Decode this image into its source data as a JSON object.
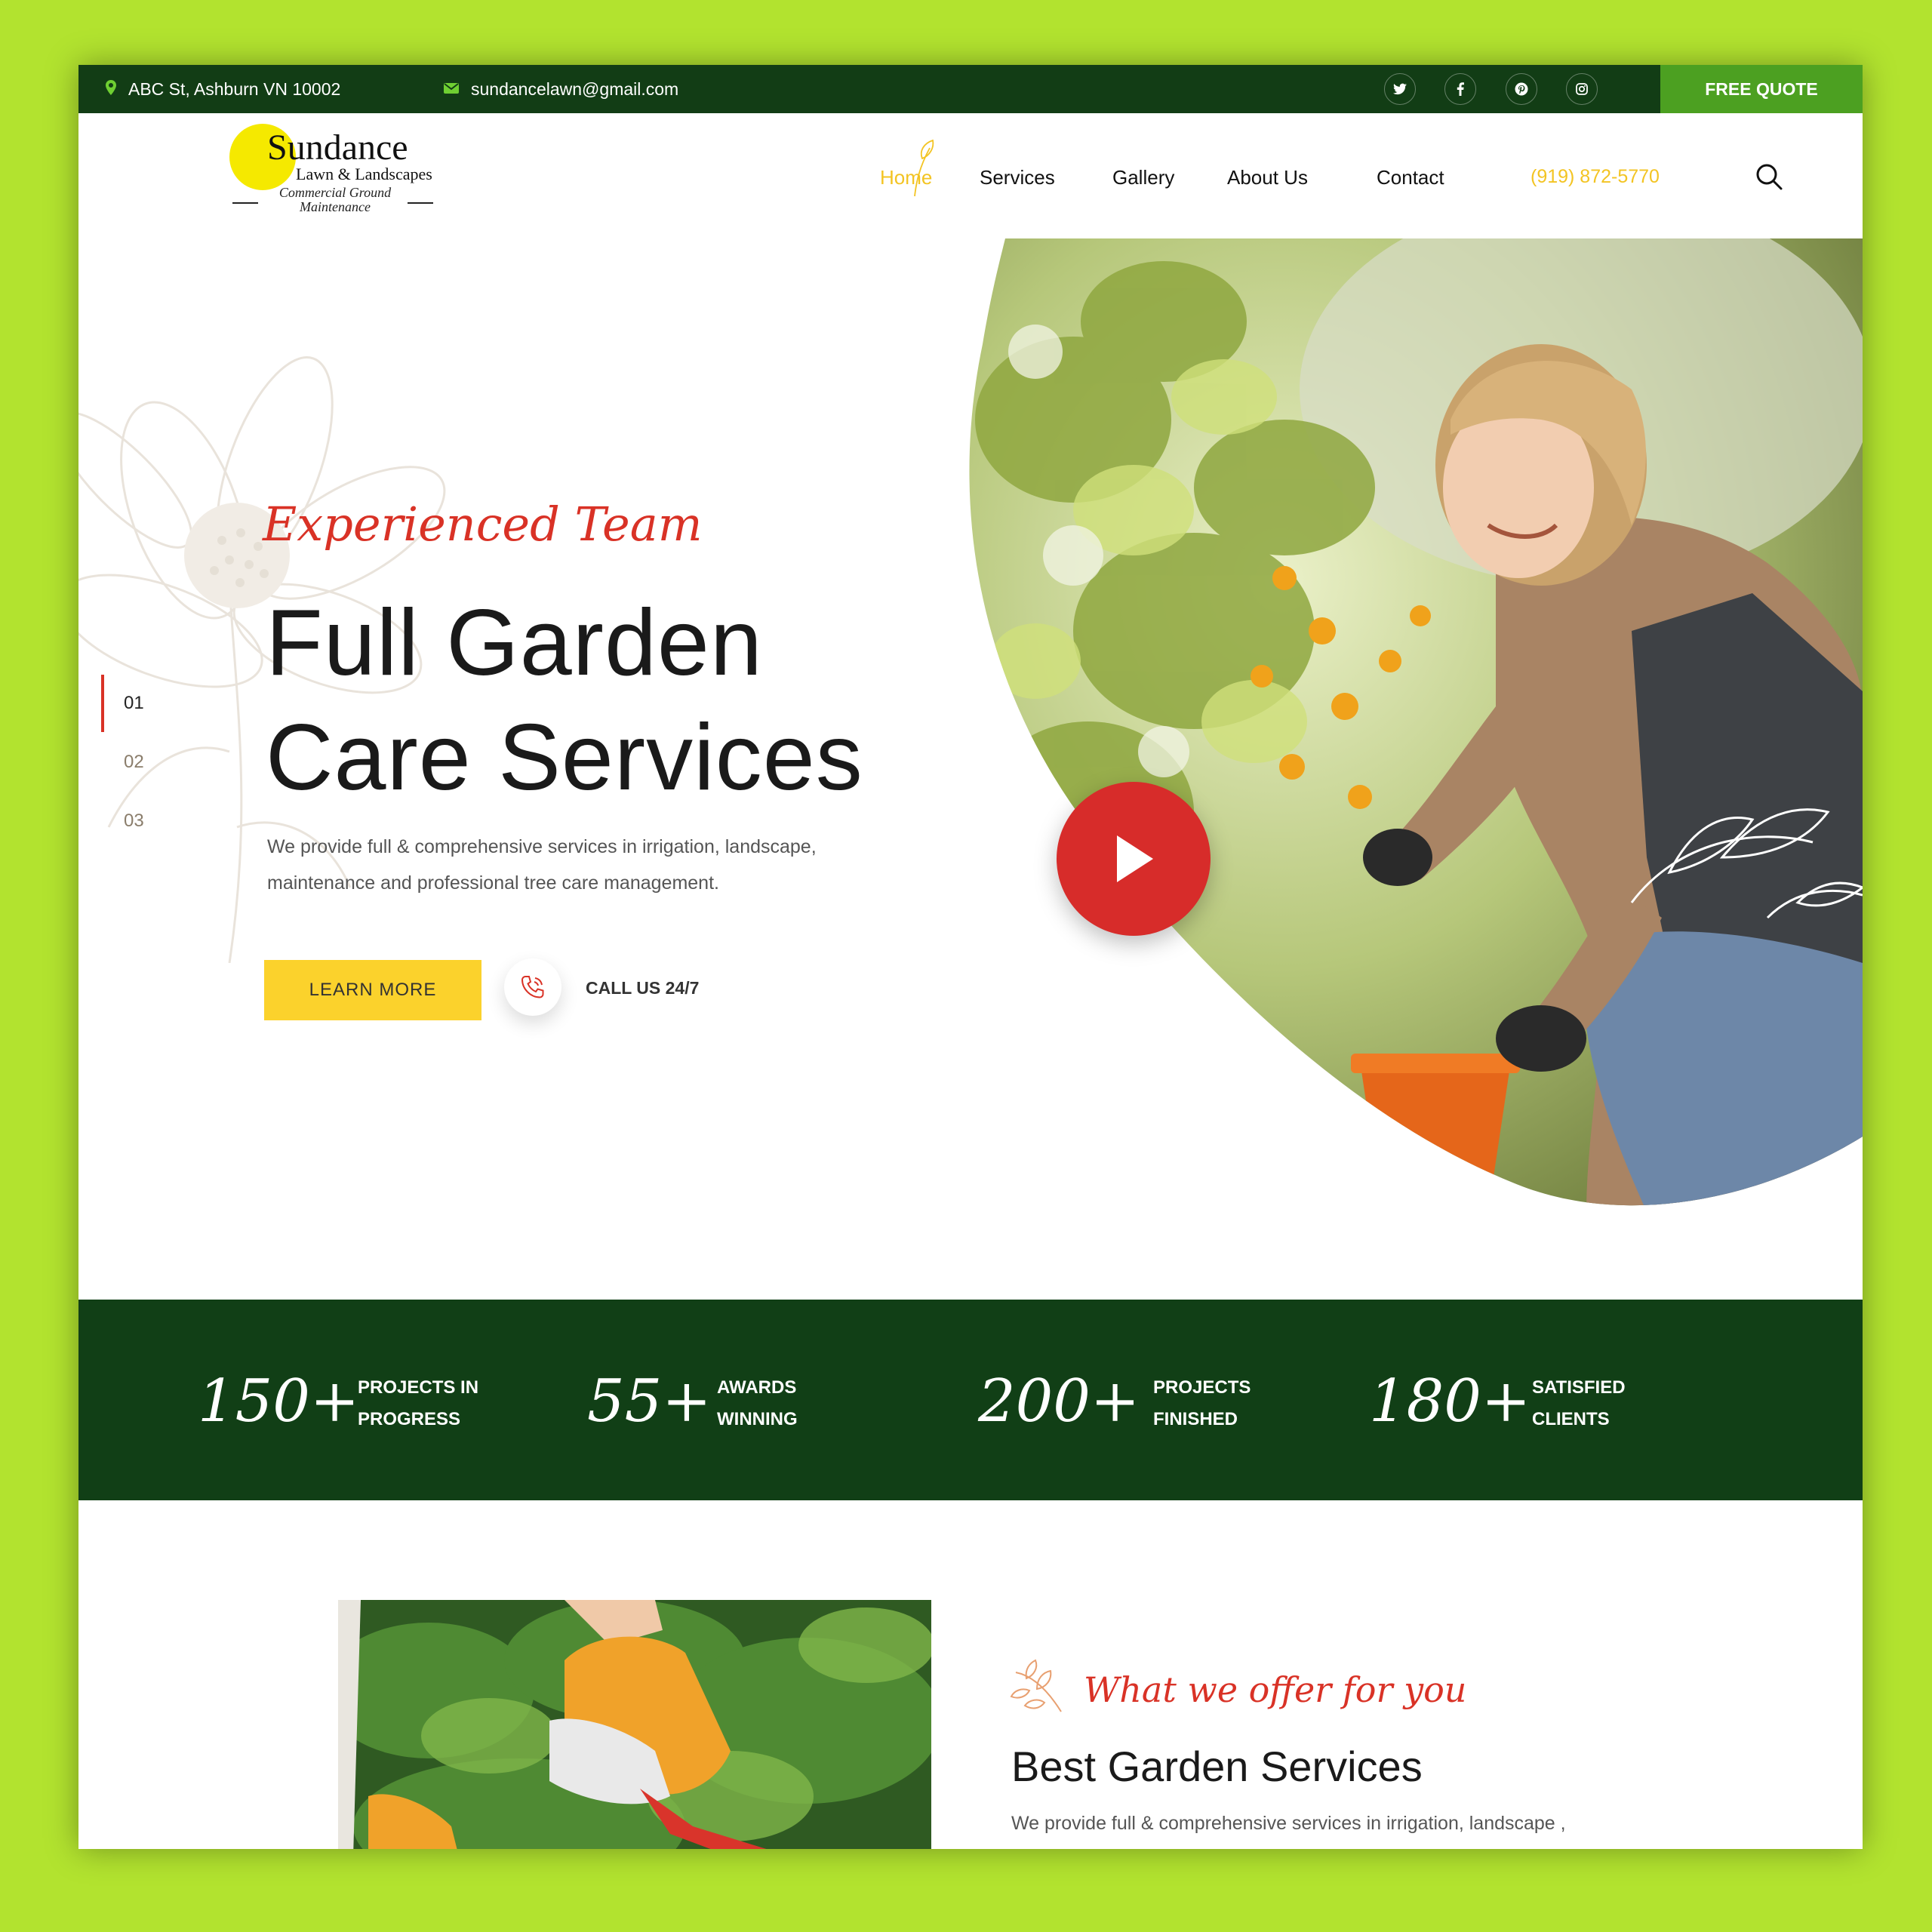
{
  "topbar": {
    "address": "ABC St, Ashburn VN 10002",
    "email": "sundancelawn@gmail.com",
    "social_icons": [
      "twitter-icon",
      "facebook-icon",
      "pinterest-icon",
      "instagram-icon"
    ],
    "quote_label": "FREE QUOTE"
  },
  "logo": {
    "name": "Sundance",
    "subtitle": "Lawn & Landscapes",
    "tagline": "Commercial Ground Maintenance"
  },
  "nav": {
    "items": [
      {
        "label": "Home",
        "active": true
      },
      {
        "label": "Services",
        "active": false
      },
      {
        "label": "Gallery",
        "active": false
      },
      {
        "label": "About Us",
        "active": false
      },
      {
        "label": "Contact",
        "active": false
      }
    ],
    "phone": "(919) 872-5770"
  },
  "hero": {
    "script_title": "Experienced Team",
    "title_line1": "Full Garden",
    "title_line2": "Care Services",
    "description_line1": "We provide full & comprehensive services in irrigation, landscape,",
    "description_line2": "maintenance and professional tree care management.",
    "learn_more": "LEARN MORE",
    "call_text": "CALL US 24/7",
    "slides": [
      "01",
      "02",
      "03"
    ],
    "active_slide": "01"
  },
  "stats": [
    {
      "number": "150+",
      "label_line1": "PROJECTS IN",
      "label_line2": "PROGRESS"
    },
    {
      "number": "55+",
      "label_line1": "AWARDS",
      "label_line2": "WINNING"
    },
    {
      "number": "200+",
      "label_line1": "PROJECTS",
      "label_line2": "FINISHED"
    },
    {
      "number": "180+",
      "label_line1": "SATISFIED",
      "label_line2": "CLIENTS"
    }
  ],
  "offer": {
    "script_title": "What we offer for you",
    "title": "Best Garden Services",
    "description": "We provide full & comprehensive services in irrigation, landscape ,"
  },
  "colors": {
    "page_bg": "#b2e32f",
    "dark_green": "#123d15",
    "accent_green": "#4ca021",
    "accent_yellow": "#fbd22c",
    "accent_red": "#d72c2a"
  }
}
